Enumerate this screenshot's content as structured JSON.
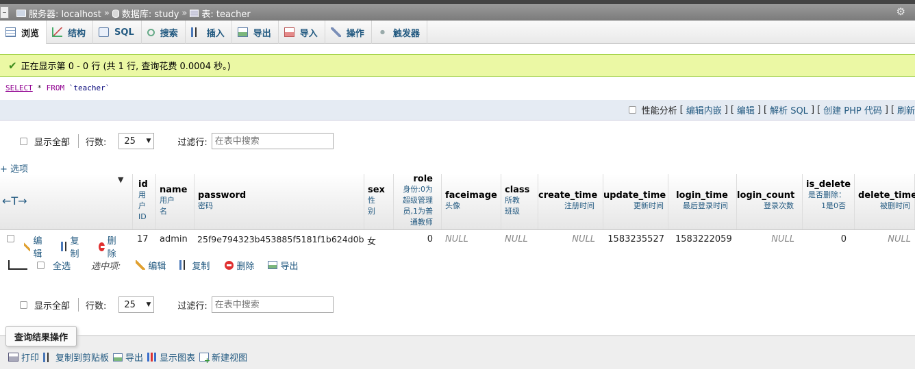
{
  "breadcrumb": {
    "server_label": "服务器: localhost",
    "database_label": "数据库: study",
    "table_label": "表: teacher",
    "separator": "»"
  },
  "tabs": [
    {
      "label": "浏览",
      "icon": "browse-icon",
      "active": true
    },
    {
      "label": "结构",
      "icon": "structure-icon"
    },
    {
      "label": "SQL",
      "icon": "sql-icon"
    },
    {
      "label": "搜索",
      "icon": "search-icon"
    },
    {
      "label": "插入",
      "icon": "insert-icon"
    },
    {
      "label": "导出",
      "icon": "export-icon"
    },
    {
      "label": "导入",
      "icon": "import-icon"
    },
    {
      "label": "操作",
      "icon": "operations-icon"
    },
    {
      "label": "触发器",
      "icon": "triggers-icon"
    }
  ],
  "message": {
    "text": "正在显示第 0 - 0 行 (共 1 行, 查询花费 0.0004 秒。)"
  },
  "sql": {
    "select": "SELECT",
    "star": "*",
    "from": "FROM",
    "table": "`teacher`"
  },
  "sql_links": {
    "profiling": "性能分析",
    "edit_inline": "编辑内嵌",
    "edit": "编辑",
    "explain": "解析 SQL",
    "php_code": "创建 PHP 代码",
    "refresh": "刷新"
  },
  "navigation": {
    "show_all": "显示全部",
    "rows_label": "行数:",
    "rows_value": "25",
    "filter_label": "过滤行:",
    "filter_placeholder": "在表中搜索"
  },
  "options_link": "+ 选项",
  "sort_arrows": "←T→",
  "columns": [
    {
      "name": "id",
      "comment": "用户ID"
    },
    {
      "name": "name",
      "comment": "用户名"
    },
    {
      "name": "password",
      "comment": "密码"
    },
    {
      "name": "sex",
      "comment": "性别"
    },
    {
      "name": "role",
      "comment": "身份:0为超级管理员,1为普通教师"
    },
    {
      "name": "faceimage",
      "comment": "头像"
    },
    {
      "name": "class",
      "comment": "所教班级"
    },
    {
      "name": "create_time",
      "comment": "注册时间"
    },
    {
      "name": "update_time",
      "comment": "更新时间"
    },
    {
      "name": "login_time",
      "comment": "最后登录时间"
    },
    {
      "name": "login_count",
      "comment": "登录次数"
    },
    {
      "name": "is_delete",
      "comment": "是否删除：1是0否"
    },
    {
      "name": "delete_time",
      "comment": "被删时间"
    }
  ],
  "row_actions": {
    "edit": "编辑",
    "copy": "复制",
    "delete": "删除"
  },
  "rows": [
    {
      "id": "17",
      "name": "admin",
      "password": "25f9e794323b453885f5181f1b624d0b",
      "sex": "女",
      "role": "0",
      "faceimage": "NULL",
      "class": "NULL",
      "create_time": "NULL",
      "update_time": "1583235527",
      "login_time": "1583222059",
      "login_count": "NULL",
      "is_delete": "0",
      "delete_time": "NULL"
    }
  ],
  "bulk": {
    "check_all": "全选",
    "with_selected": "选中项:",
    "edit": "编辑",
    "copy": "复制",
    "delete": "删除",
    "export": "导出"
  },
  "query_results": {
    "legend": "查询结果操作",
    "print": "打印",
    "copy_clipboard": "复制到剪贴板",
    "export": "导出",
    "display_chart": "显示图表",
    "create_view": "新建视图"
  },
  "colors": {
    "link": "#235a81",
    "success_bg": "#ebf8a4",
    "success_border": "#a2d246",
    "sql_keyword": "#900090"
  }
}
